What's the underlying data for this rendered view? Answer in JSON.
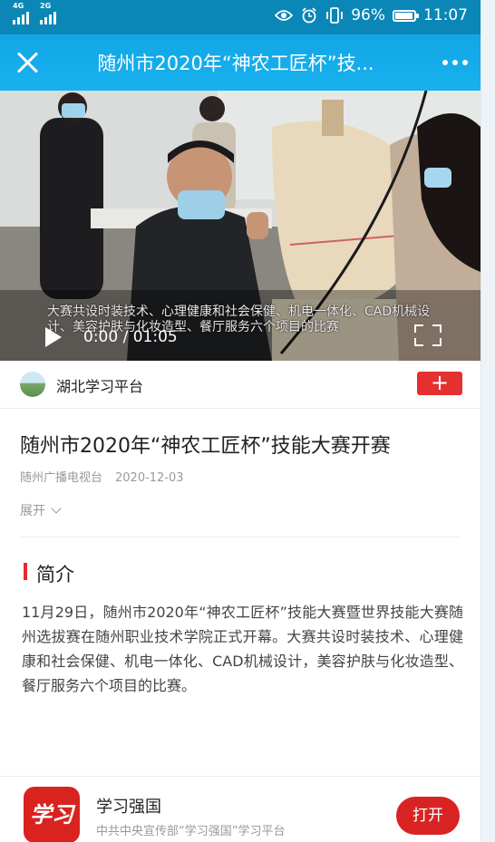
{
  "status_bar": {
    "network_1": "4G",
    "network_2": "2G",
    "battery": "96%",
    "time": "11:07"
  },
  "header": {
    "title": "随州市2020年“神农工匠杯”技...",
    "close_icon": "close-icon",
    "more_icon": "more-icon"
  },
  "video": {
    "subtitle": "大赛共设时装技术、心理健康和社会保健、机电一体化、CAD机械设计、美容护肤与化妆造型、餐厅服务六个项目的比赛",
    "time": "0:00 / 01:05",
    "progress": 0
  },
  "channel": {
    "name": "湖北学习平台",
    "follow_label": "+"
  },
  "article": {
    "title": "随州市2020年“神农工匠杯”技能大赛开赛",
    "source": "随州广播电视台",
    "date": "2020-12-03",
    "expand_label": "展开"
  },
  "intro": {
    "heading": "简介",
    "text": "11月29日，随州市2020年“神农工匠杯”技能大赛暨世界技能大赛随州选拔赛在随州职业技术学院正式开幕。大赛共设时装技术、心理健康和社会保健、机电一体化、CAD机械设计，美容护肤与化妆造型、餐厅服务六个项目的比赛。"
  },
  "app_bar": {
    "logo_text": "学习",
    "name": "学习强国",
    "description": "中共中央宣传部“学习强国”学习平台",
    "open_label": "打开"
  },
  "colors": {
    "status_bar": "#0a87b6",
    "header": "#15acea",
    "accent_red": "#e53030"
  }
}
